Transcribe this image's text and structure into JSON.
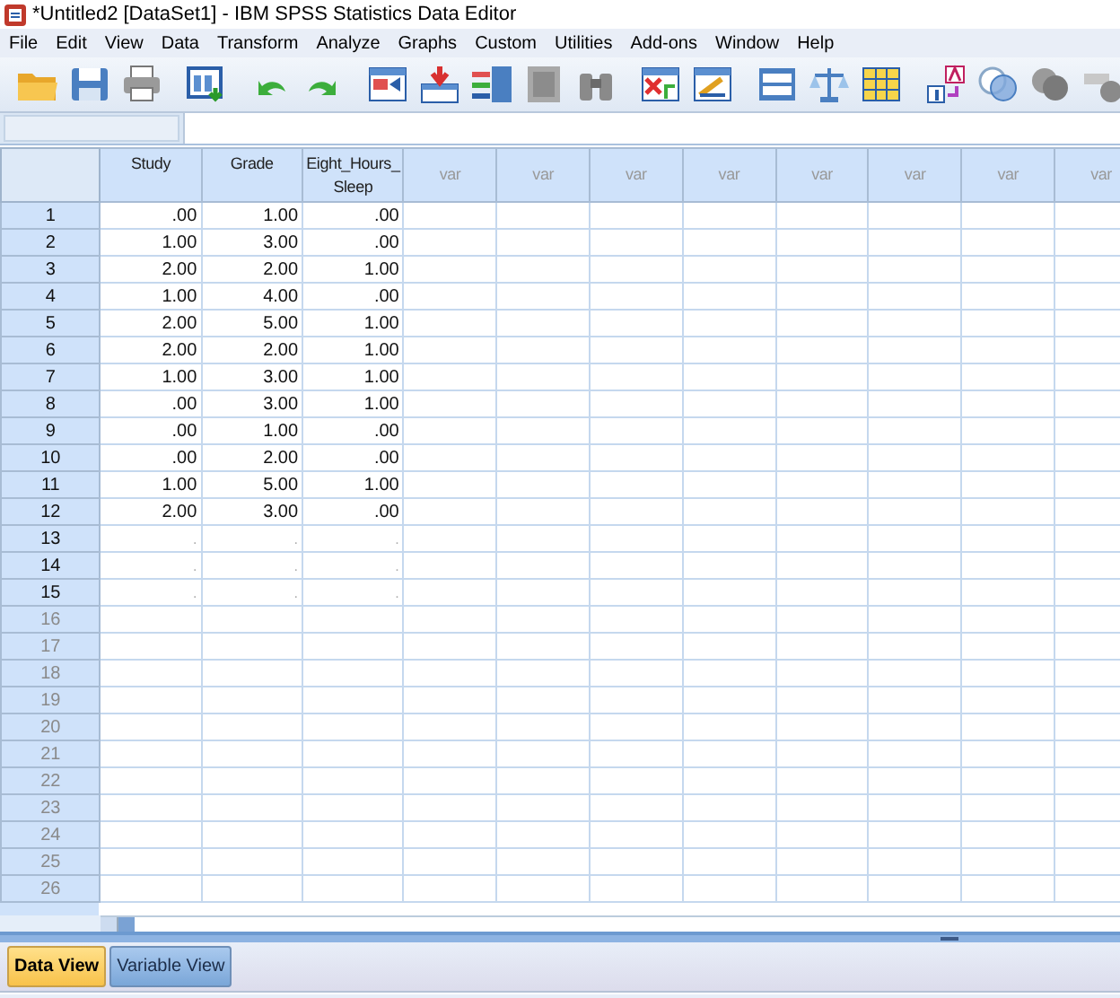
{
  "window": {
    "title": "*Untitled2 [DataSet1] - IBM SPSS Statistics Data Editor"
  },
  "menu": [
    "File",
    "Edit",
    "View",
    "Data",
    "Transform",
    "Analyze",
    "Graphs",
    "Custom",
    "Utilities",
    "Add-ons",
    "Window",
    "Help"
  ],
  "grid": {
    "columns": [
      {
        "label": "Study",
        "kind": "variable"
      },
      {
        "label": "Grade",
        "kind": "variable"
      },
      {
        "label": "Eight_Hours_ Sleep",
        "kind": "variable"
      },
      {
        "label": "var",
        "kind": "placeholder"
      },
      {
        "label": "var",
        "kind": "placeholder"
      },
      {
        "label": "var",
        "kind": "placeholder"
      },
      {
        "label": "var",
        "kind": "placeholder"
      },
      {
        "label": "var",
        "kind": "placeholder"
      },
      {
        "label": "var",
        "kind": "placeholder"
      },
      {
        "label": "var",
        "kind": "placeholder"
      },
      {
        "label": "var",
        "kind": "placeholder"
      }
    ],
    "rows": [
      {
        "number": "1",
        "in_use": true,
        "cells": [
          ".00",
          "1.00",
          ".00"
        ]
      },
      {
        "number": "2",
        "in_use": true,
        "cells": [
          "1.00",
          "3.00",
          ".00"
        ]
      },
      {
        "number": "3",
        "in_use": true,
        "cells": [
          "2.00",
          "2.00",
          "1.00"
        ]
      },
      {
        "number": "4",
        "in_use": true,
        "cells": [
          "1.00",
          "4.00",
          ".00"
        ]
      },
      {
        "number": "5",
        "in_use": true,
        "cells": [
          "2.00",
          "5.00",
          "1.00"
        ]
      },
      {
        "number": "6",
        "in_use": true,
        "cells": [
          "2.00",
          "2.00",
          "1.00"
        ]
      },
      {
        "number": "7",
        "in_use": true,
        "cells": [
          "1.00",
          "3.00",
          "1.00"
        ]
      },
      {
        "number": "8",
        "in_use": true,
        "cells": [
          ".00",
          "3.00",
          "1.00"
        ]
      },
      {
        "number": "9",
        "in_use": true,
        "cells": [
          ".00",
          "1.00",
          ".00"
        ]
      },
      {
        "number": "10",
        "in_use": true,
        "cells": [
          ".00",
          "2.00",
          ".00"
        ]
      },
      {
        "number": "11",
        "in_use": true,
        "cells": [
          "1.00",
          "5.00",
          "1.00"
        ]
      },
      {
        "number": "12",
        "in_use": true,
        "cells": [
          "2.00",
          "3.00",
          ".00"
        ]
      },
      {
        "number": "13",
        "in_use": true,
        "cells": [
          ".",
          ".",
          "."
        ]
      },
      {
        "number": "14",
        "in_use": true,
        "cells": [
          ".",
          ".",
          "."
        ]
      },
      {
        "number": "15",
        "in_use": true,
        "cells": [
          ".",
          ".",
          "."
        ]
      },
      {
        "number": "16",
        "in_use": false,
        "cells": []
      },
      {
        "number": "17",
        "in_use": false,
        "cells": []
      },
      {
        "number": "18",
        "in_use": false,
        "cells": []
      },
      {
        "number": "19",
        "in_use": false,
        "cells": []
      },
      {
        "number": "20",
        "in_use": false,
        "cells": []
      },
      {
        "number": "21",
        "in_use": false,
        "cells": []
      },
      {
        "number": "22",
        "in_use": false,
        "cells": []
      },
      {
        "number": "23",
        "in_use": false,
        "cells": []
      },
      {
        "number": "24",
        "in_use": false,
        "cells": []
      },
      {
        "number": "25",
        "in_use": false,
        "cells": []
      },
      {
        "number": "26",
        "in_use": false,
        "cells": []
      }
    ]
  },
  "tabs": [
    {
      "label": "Data View",
      "selected": true
    },
    {
      "label": "Variable View",
      "selected": false
    }
  ]
}
